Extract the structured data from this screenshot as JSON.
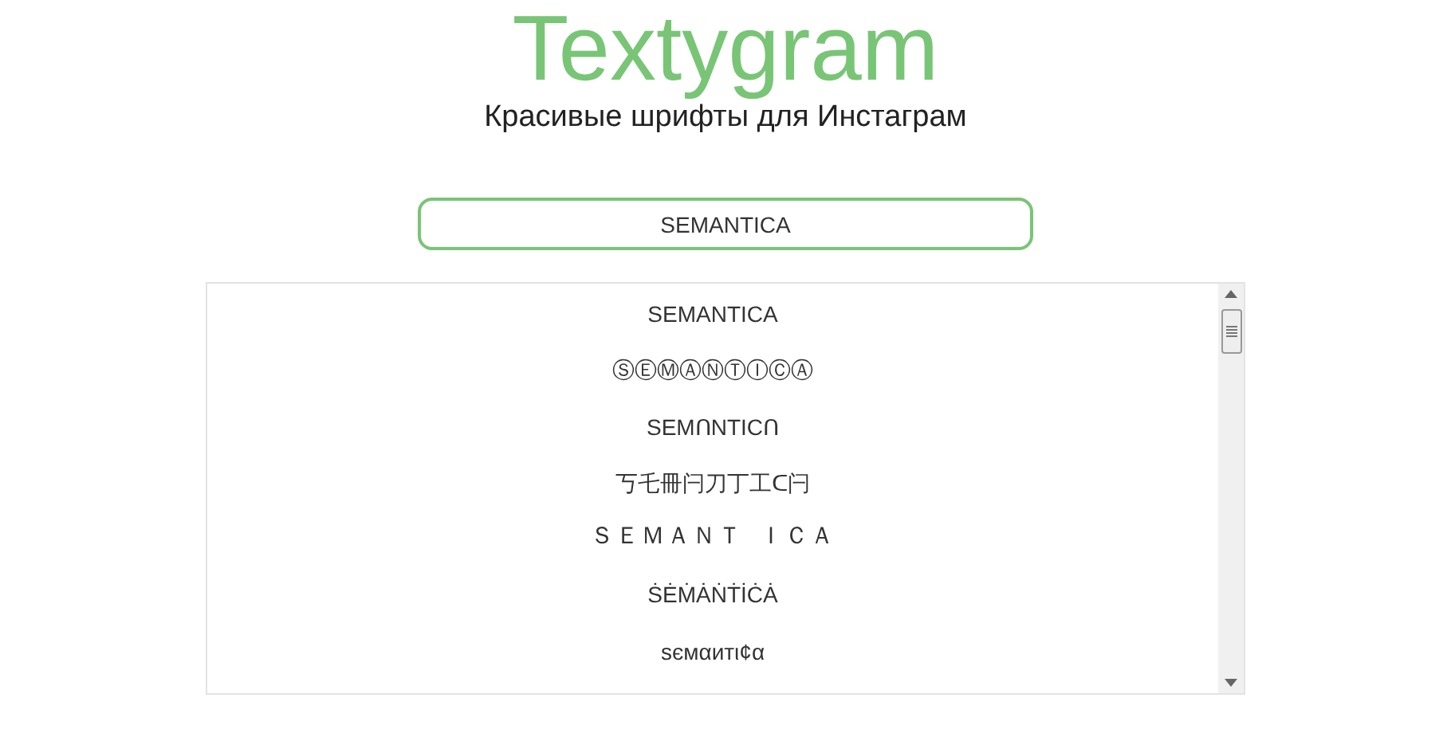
{
  "header": {
    "logo": "Textygram",
    "tagline": "Красивые шрифты для Инстаграм"
  },
  "input": {
    "value": "SEMANTICA"
  },
  "results": [
    {
      "text": "SEMANTICA",
      "kind": "plain"
    },
    {
      "text": "ⓈⒺⓂⒶⓃⓉⒾⒸⒶ",
      "kind": "plain"
    },
    {
      "text": "SEMᑎNTICᑎ",
      "kind": "plain"
    },
    {
      "text": "丂乇冊闩刀丁工ᑕ闩",
      "kind": "plain"
    },
    {
      "text": "ＳＥＭＡＮＴ ＩＣＡ",
      "kind": "mono"
    },
    {
      "text": "ṠĖṀȦṄṪİĊȦ",
      "kind": "plain"
    },
    {
      "text": "ѕємαитι¢α",
      "kind": "plain"
    }
  ]
}
